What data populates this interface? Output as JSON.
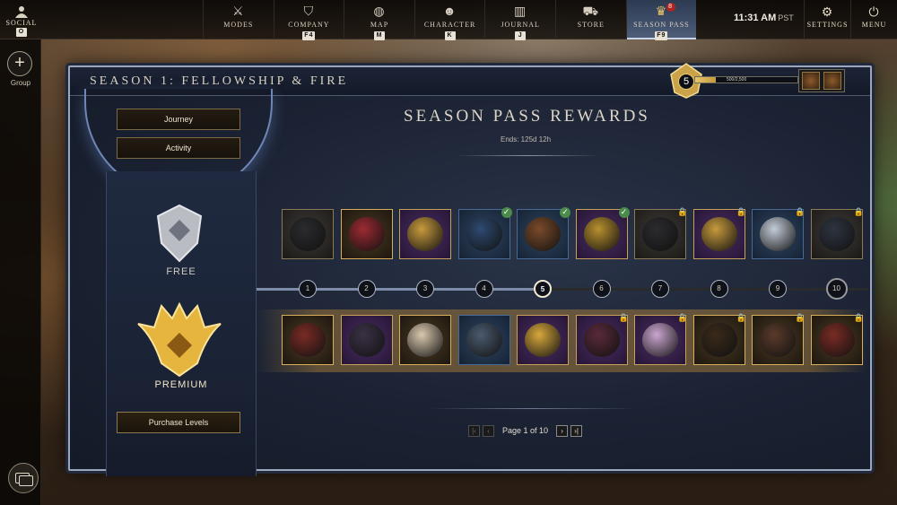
{
  "topbar": {
    "social": {
      "label": "SOCIAL",
      "key": "O",
      "icon": "social-icon"
    },
    "tabs": [
      {
        "label": "MODES",
        "key": "",
        "icon": "crossed-swords-icon"
      },
      {
        "label": "COMPANY",
        "key": "F4",
        "icon": "shield-icon"
      },
      {
        "label": "MAP",
        "key": "M",
        "icon": "globe-icon"
      },
      {
        "label": "CHARACTER",
        "key": "K",
        "icon": "character-icon"
      },
      {
        "label": "JOURNAL",
        "key": "J",
        "icon": "book-icon"
      },
      {
        "label": "STORE",
        "key": "",
        "icon": "cart-icon"
      },
      {
        "label": "SEASON PASS",
        "key": "F9",
        "icon": "season-pass-icon",
        "badge": "8"
      }
    ],
    "clock": {
      "time": "11:31 AM",
      "zone": "PST"
    },
    "settings_label": "SETTINGS",
    "menu_label": "MENU"
  },
  "rail": {
    "group_label": "Group"
  },
  "panel": {
    "season_title": "SEASON 1: FELLOWSHIP & FIRE",
    "level": "5",
    "xp_text": "500/2,500",
    "xp_fraction": 0.2
  },
  "left": {
    "journey_label": "Journey",
    "activity_label": "Activity",
    "free_label": "FREE",
    "premium_label": "PREMIUM",
    "purchase_label": "Purchase Levels"
  },
  "rewards": {
    "title": "SEASON PASS REWARDS",
    "ends": "Ends: 125d 12h",
    "levels": [
      "1",
      "2",
      "3",
      "4",
      "5",
      "6",
      "7",
      "8",
      "9",
      "10"
    ],
    "current_level": 5
  },
  "pager": {
    "label": "Page 1 of 10"
  }
}
